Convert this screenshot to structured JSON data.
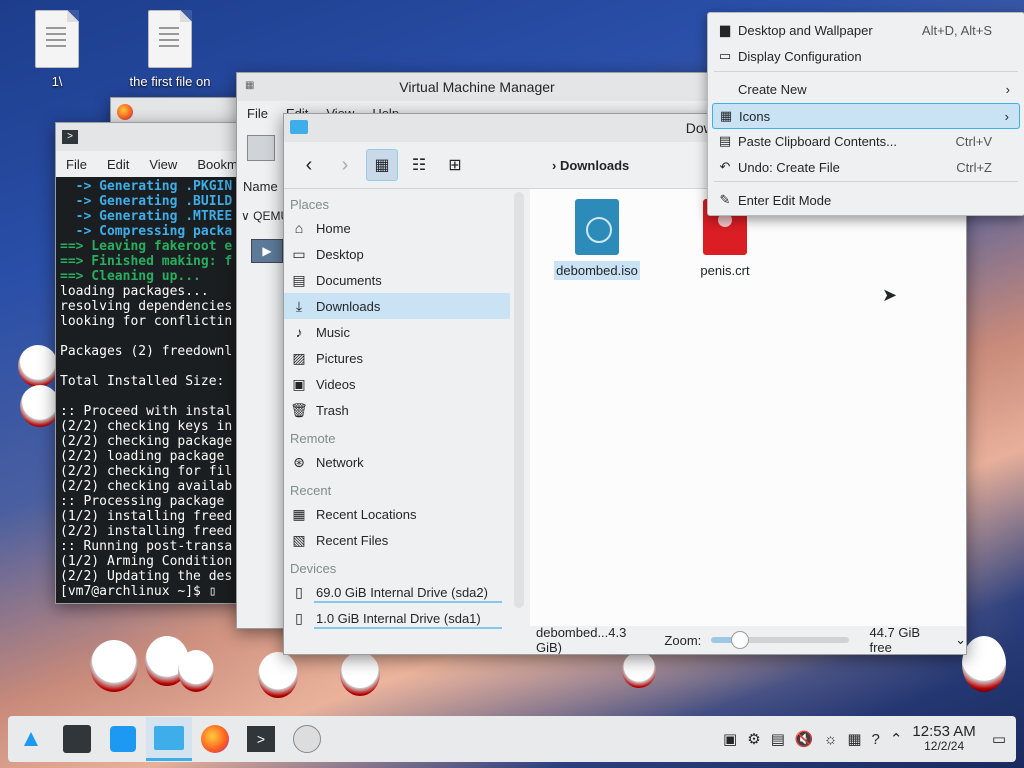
{
  "desktop": {
    "icons": [
      {
        "label": "1\\"
      },
      {
        "label": "the first file on"
      }
    ]
  },
  "terminal": {
    "menu": [
      "File",
      "Edit",
      "View",
      "Bookm"
    ],
    "lines": [
      {
        "t": "  -> Generating .PKGIN",
        "k": "c"
      },
      {
        "t": "  -> Generating .BUILD",
        "k": "c"
      },
      {
        "t": "  -> Generating .MTREE",
        "k": "c"
      },
      {
        "t": "  -> Compressing packa",
        "k": "c"
      },
      {
        "t": "==> Leaving fakeroot e",
        "k": "g"
      },
      {
        "t": "==> Finished making: f",
        "k": "g"
      },
      {
        "t": "==> Cleaning up...",
        "k": "g"
      },
      {
        "t": "loading packages...",
        "k": ""
      },
      {
        "t": "resolving dependencies",
        "k": ""
      },
      {
        "t": "looking for conflictin",
        "k": ""
      },
      {
        "t": "",
        "k": ""
      },
      {
        "t": "Packages (2) freedownl",
        "k": ""
      },
      {
        "t": "",
        "k": ""
      },
      {
        "t": "Total Installed Size:",
        "k": ""
      },
      {
        "t": "",
        "k": ""
      },
      {
        "t": ":: Proceed with instal",
        "k": ""
      },
      {
        "t": "(2/2) checking keys in",
        "k": ""
      },
      {
        "t": "(2/2) checking package",
        "k": ""
      },
      {
        "t": "(2/2) loading package",
        "k": ""
      },
      {
        "t": "(2/2) checking for fil",
        "k": ""
      },
      {
        "t": "(2/2) checking availab",
        "k": ""
      },
      {
        "t": ":: Processing package",
        "k": ""
      },
      {
        "t": "(1/2) installing freed",
        "k": ""
      },
      {
        "t": "(2/2) installing freed",
        "k": ""
      },
      {
        "t": ":: Running post-transa",
        "k": ""
      },
      {
        "t": "(1/2) Arming Condition",
        "k": ""
      },
      {
        "t": "(2/2) Updating the des",
        "k": ""
      },
      {
        "t": "[vm7@archlinux ~]$ ▯",
        "k": ""
      }
    ]
  },
  "vmm": {
    "title": "Virtual Machine Manager",
    "menu": [
      "File",
      "Edit",
      "View",
      "Help"
    ],
    "col": "Name",
    "row": "QEMU"
  },
  "dolphin": {
    "title": "Downloads — Dolphin",
    "breadcrumb": "Downloads",
    "sections": [
      {
        "header": "Places",
        "items": [
          {
            "icon": "home-icon",
            "glyph": "⌂",
            "label": "Home",
            "sel": false
          },
          {
            "icon": "desktop-icon",
            "glyph": "▭",
            "label": "Desktop",
            "sel": false
          },
          {
            "icon": "documents-icon",
            "glyph": "▤",
            "label": "Documents",
            "sel": false
          },
          {
            "icon": "downloads-icon",
            "glyph": "⤓",
            "label": "Downloads",
            "sel": true
          },
          {
            "icon": "music-icon",
            "glyph": "♪",
            "label": "Music",
            "sel": false
          },
          {
            "icon": "pictures-icon",
            "glyph": "▨",
            "label": "Pictures",
            "sel": false
          },
          {
            "icon": "videos-icon",
            "glyph": "▣",
            "label": "Videos",
            "sel": false
          },
          {
            "icon": "trash-icon",
            "glyph": "🗑",
            "label": "Trash",
            "sel": false
          }
        ]
      },
      {
        "header": "Remote",
        "items": [
          {
            "icon": "network-icon",
            "glyph": "⊛",
            "label": "Network",
            "sel": false
          }
        ]
      },
      {
        "header": "Recent",
        "items": [
          {
            "icon": "recent-locations-icon",
            "glyph": "▦",
            "label": "Recent Locations",
            "sel": false
          },
          {
            "icon": "recent-files-icon",
            "glyph": "▧",
            "label": "Recent Files",
            "sel": false
          }
        ]
      },
      {
        "header": "Devices",
        "items": [
          {
            "icon": "drive-icon",
            "glyph": "▯",
            "label": "69.0 GiB Internal Drive (sda2)",
            "sel": false
          },
          {
            "icon": "drive-icon",
            "glyph": "▯",
            "label": "1.0 GiB Internal Drive (sda1)",
            "sel": false
          }
        ]
      }
    ],
    "files": [
      {
        "name": "debombed.iso",
        "selected": true
      },
      {
        "name": "penis.crt",
        "selected": false
      }
    ],
    "status": {
      "left": "debombed...4.3 GiB)",
      "zoom": "Zoom:",
      "zoom_level": 0.2,
      "free": "44.7 GiB free"
    }
  },
  "menu": {
    "items": [
      {
        "icon": "wallpaper-icon",
        "glyph": "▆",
        "label": "Desktop and Wallpaper",
        "shortcut": "Alt+D, Alt+S",
        "arrow": false,
        "hl": false
      },
      {
        "icon": "display-icon",
        "glyph": "▭",
        "label": "Display Configuration",
        "shortcut": "",
        "arrow": false,
        "hl": false
      },
      {
        "icon": "",
        "glyph": "",
        "label": "Create New",
        "shortcut": "",
        "arrow": true,
        "hl": false
      },
      {
        "icon": "icons-grid-icon",
        "glyph": "▦",
        "label": "Icons",
        "shortcut": "",
        "arrow": true,
        "hl": true
      },
      {
        "icon": "paste-icon",
        "glyph": "▤",
        "label": "Paste Clipboard Contents...",
        "shortcut": "Ctrl+V",
        "arrow": false,
        "hl": false
      },
      {
        "icon": "undo-icon",
        "glyph": "↶",
        "label": "Undo: Create File",
        "shortcut": "Ctrl+Z",
        "arrow": false,
        "hl": false
      },
      {
        "icon": "edit-mode-icon",
        "glyph": "✎",
        "label": "Enter Edit Mode",
        "shortcut": "",
        "arrow": false,
        "hl": false
      }
    ]
  },
  "taskbar": {
    "time": "12:53 AM",
    "date": "12/2/24"
  }
}
